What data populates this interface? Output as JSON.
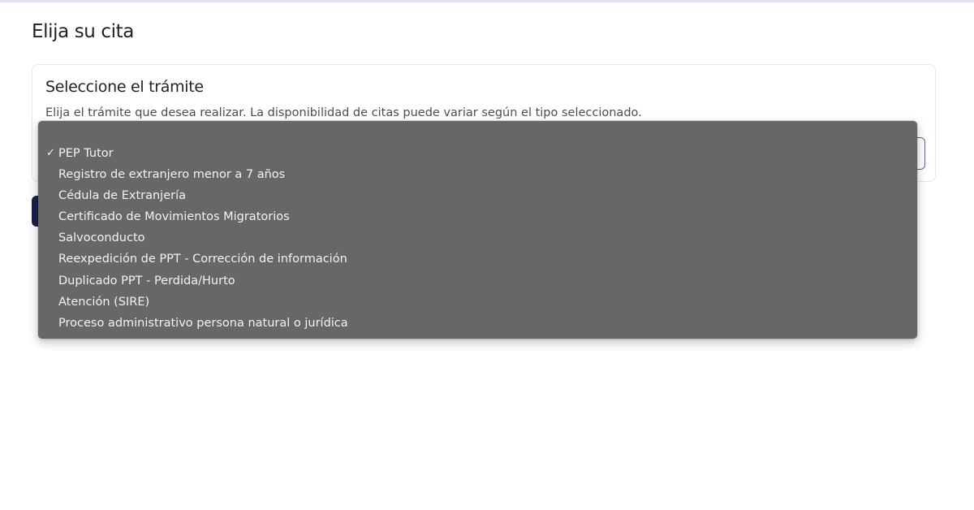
{
  "page": {
    "title": "Elija su cita"
  },
  "card": {
    "title": "Seleccione el trámite",
    "description": "Elija el trámite que desea realizar. La disponibilidad de citas puede variar según el tipo seleccionado."
  },
  "select": {
    "selected_value": "PEP Tutor",
    "options": [
      "PEP Tutor",
      "Registro de extranjero menor a 7 años",
      "Cédula de Extranjería",
      "Certificado de Movimientos Migratorios",
      "Salvoconducto",
      "Reexpedición de PPT - Corrección de información",
      "Duplicado PPT - Perdida/Hurto",
      "Atención (SIRE)",
      "Proceso administrativo persona natural o jurídica"
    ],
    "checkmark": "✓"
  },
  "colors": {
    "accent": "#1c1f4f",
    "dropdown_bg": "#676767",
    "select_border": "#5b5f9e"
  }
}
